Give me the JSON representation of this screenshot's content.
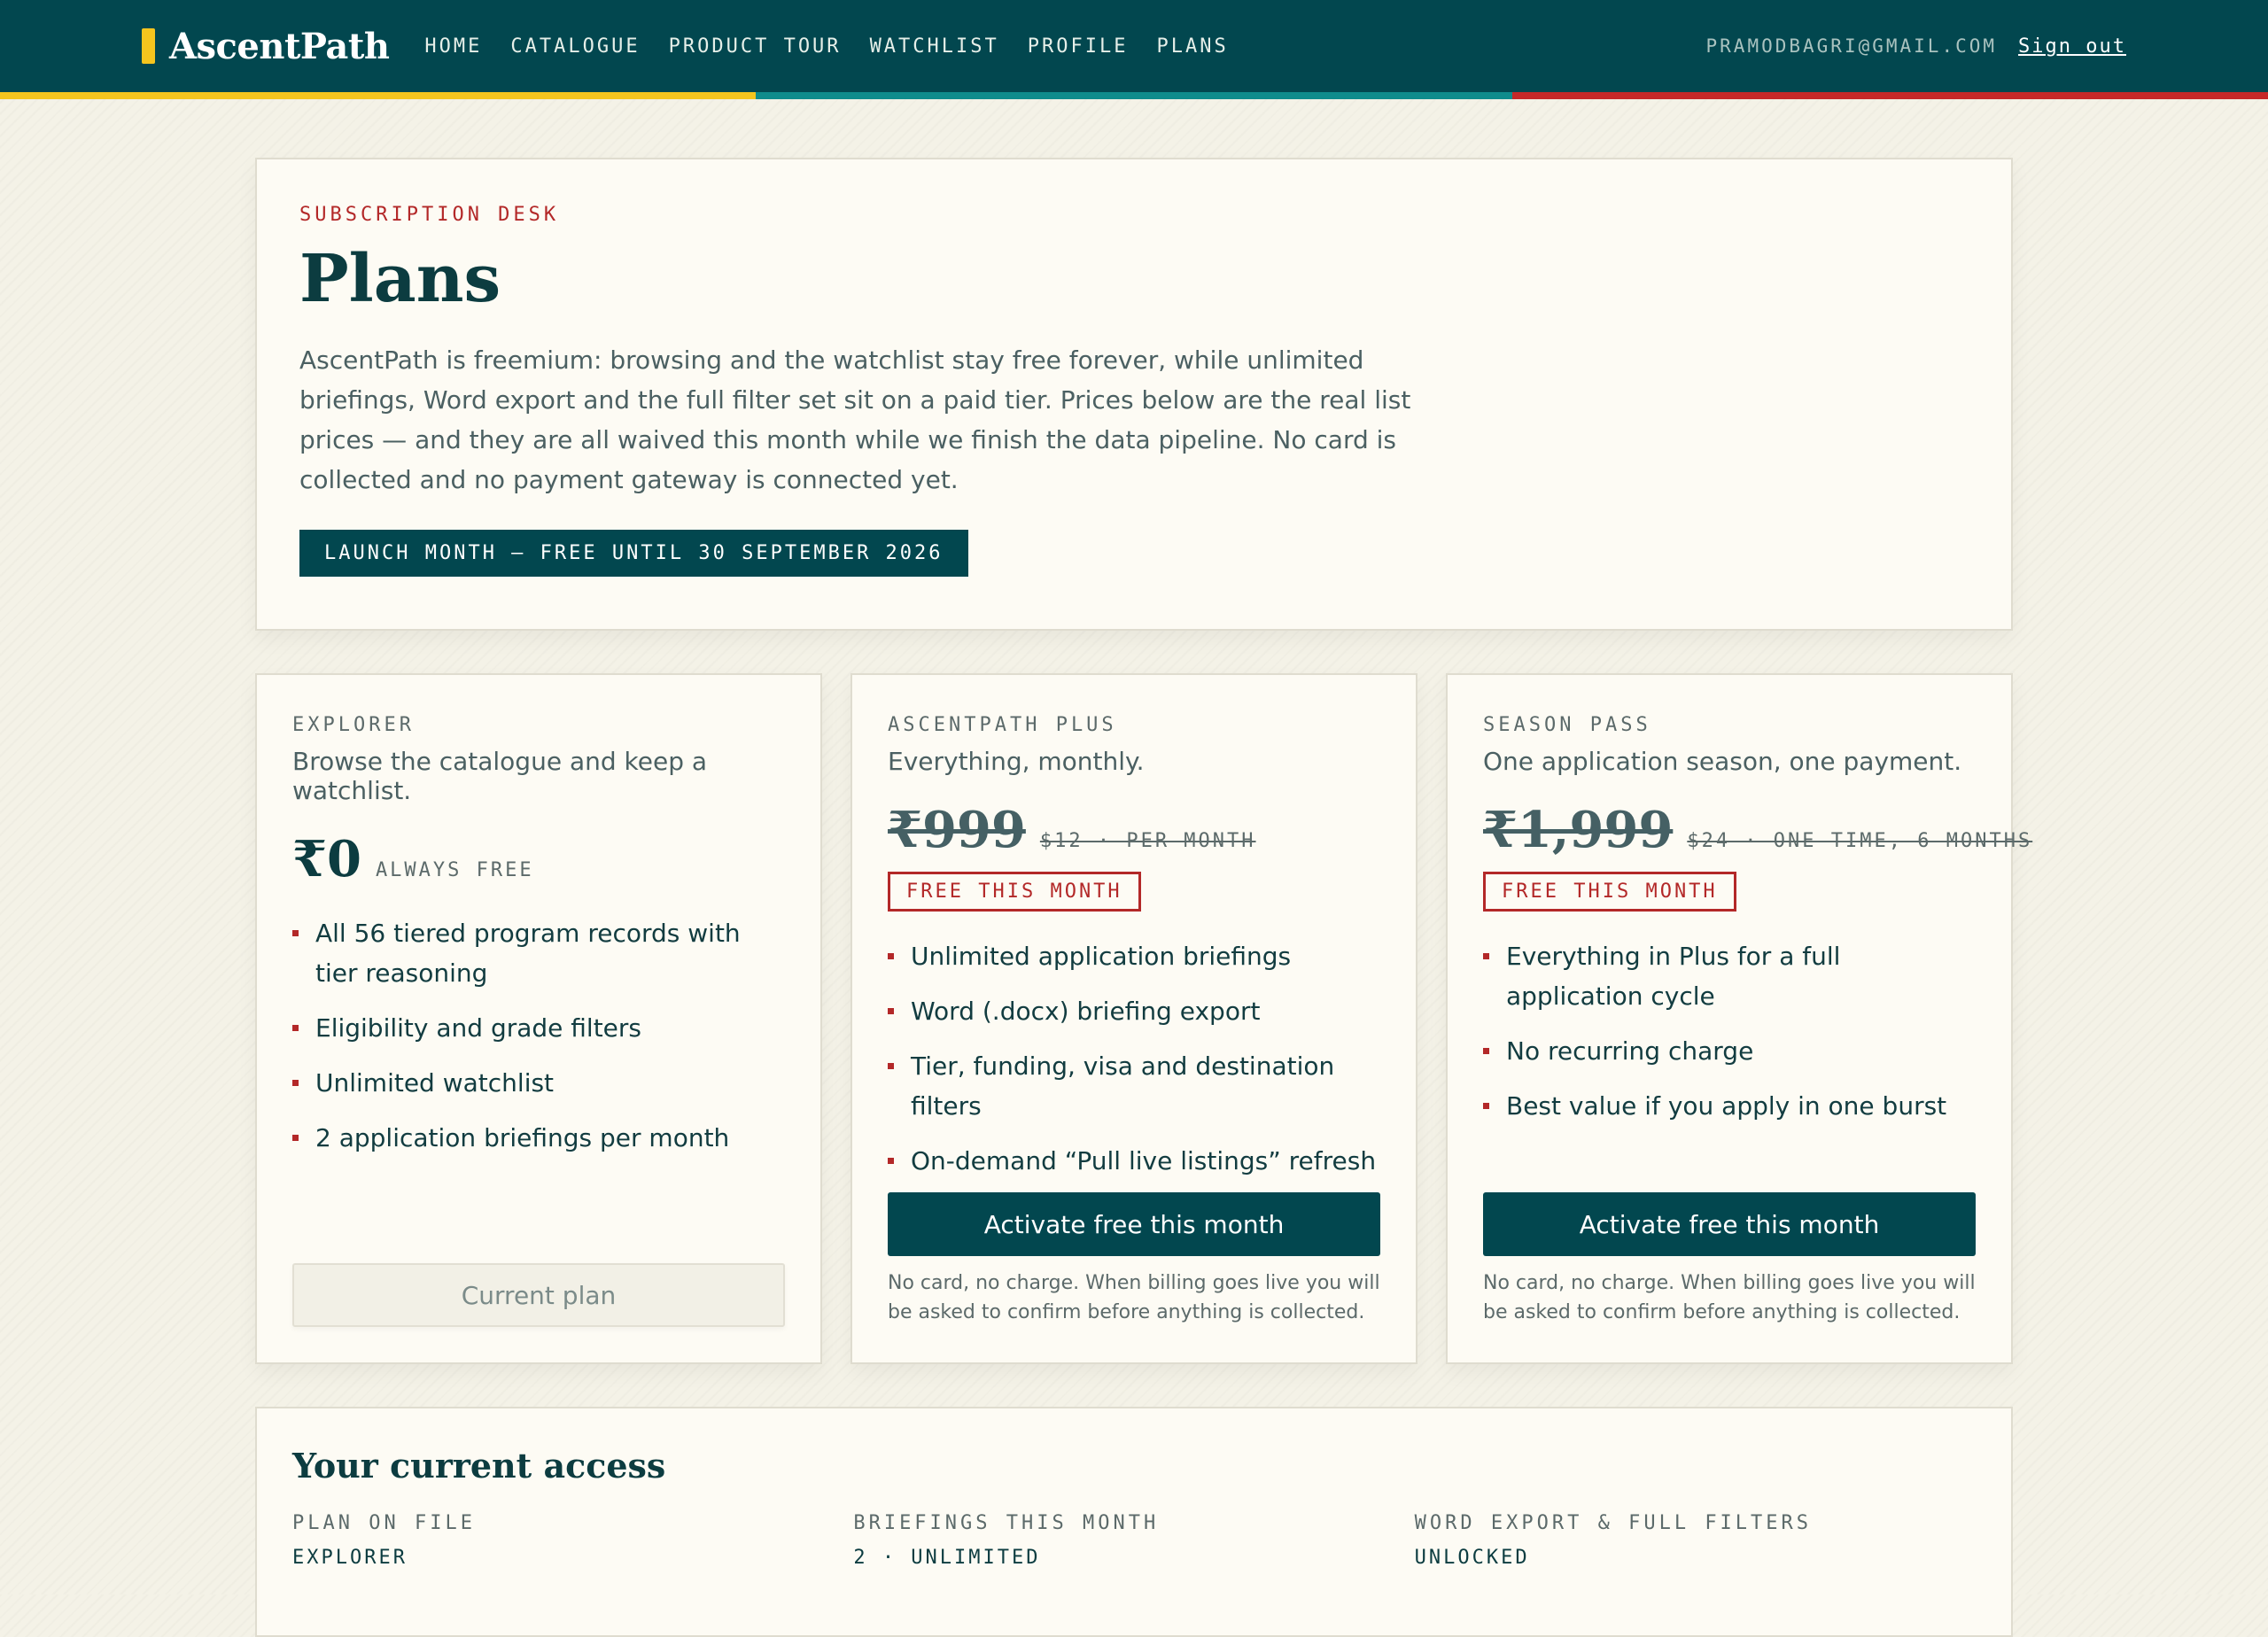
{
  "nav": {
    "brand": "AscentPath",
    "links": [
      "HOME",
      "CATALOGUE",
      "PRODUCT TOUR",
      "WATCHLIST",
      "PROFILE",
      "PLANS"
    ],
    "email": "PRAMODBAGRI@GMAIL.COM",
    "signout": "Sign out"
  },
  "colors": {
    "nav_bg": "#02474f",
    "stripe": [
      "#f5c51e",
      "#0f8c8c",
      "#c62828"
    ],
    "accent_red": "#b32828",
    "brand_mark": "#f5c51e"
  },
  "hero": {
    "eyebrow": "SUBSCRIPTION DESK",
    "title": "Plans",
    "description": "AscentPath is freemium: browsing and the watchlist stay free forever, while unlimited briefings, Word export and the full filter set sit on a paid tier. Prices below are the real list prices — and they are all waived this month while we finish the data pipeline. No card is collected and no payment gateway is connected yet.",
    "badge": "LAUNCH MONTH — FREE UNTIL 30 SEPTEMBER 2026"
  },
  "plans": [
    {
      "tier": "EXPLORER",
      "tagline": "Browse the catalogue and keep a watchlist.",
      "price": "₹0",
      "price_note": "ALWAYS FREE",
      "features": [
        "All 56 tiered program records with tier reasoning",
        "Eligibility and grade filters",
        "Unlimited watchlist",
        "2 application briefings per month"
      ],
      "button": "Current plan"
    },
    {
      "tier": "ASCENTPATH PLUS",
      "tagline": "Everything, monthly.",
      "price": "₹999",
      "price_note": "$12 · PER MONTH",
      "badge": "FREE THIS MONTH",
      "features": [
        "Unlimited application briefings",
        "Word (.docx) briefing export",
        "Tier, funding, visa and destination filters",
        "On-demand “Pull live listings” refresh"
      ],
      "button": "Activate free this month",
      "fine_print": "No card, no charge. When billing goes live you will be asked to confirm before anything is collected."
    },
    {
      "tier": "SEASON PASS",
      "tagline": "One application season, one payment.",
      "price": "₹1,999",
      "price_note": "$24 · ONE-TIME, 6 MONTHS",
      "badge": "FREE THIS MONTH",
      "features": [
        "Everything in Plus for a full application cycle",
        "No recurring charge",
        "Best value if you apply in one burst"
      ],
      "button": "Activate free this month",
      "fine_print": "No card, no charge. When billing goes live you will be asked to confirm before anything is collected."
    }
  ],
  "access": {
    "title": "Your current access",
    "items": [
      {
        "label": "PLAN ON FILE",
        "value": "EXPLORER"
      },
      {
        "label": "BRIEFINGS THIS MONTH",
        "value": "2 · UNLIMITED"
      },
      {
        "label": "WORD EXPORT & FULL FILTERS",
        "value": "UNLOCKED"
      }
    ]
  }
}
